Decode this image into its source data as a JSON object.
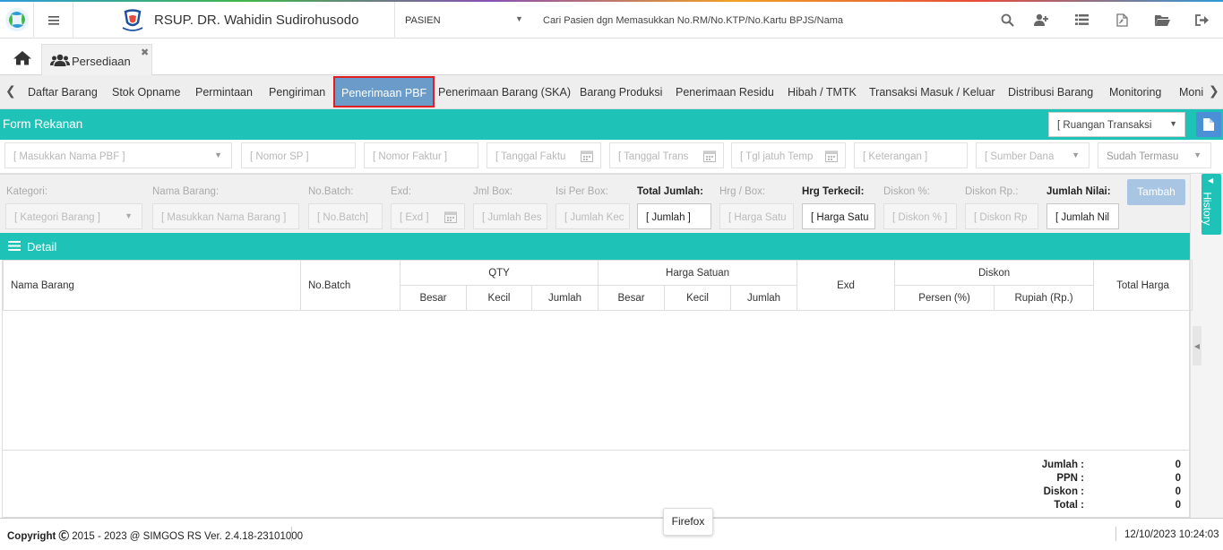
{
  "header": {
    "hospital_name": "RSUP. DR. Wahidin Sudirohusodo",
    "patient_select": "PASIEN",
    "search_placeholder": "Cari Pasien dgn Memasukkan No.RM/No.KTP/No.Kartu BPJS/Nama"
  },
  "tabs": {
    "page_tab": "Persediaan"
  },
  "menu": {
    "items": [
      "Daftar Barang",
      "Stok Opname",
      "Permintaan",
      "Pengiriman",
      "Penerimaan PBF",
      "Penerimaan Barang (SKA)",
      "Barang Produksi",
      "Penerimaan Residu",
      "Hibah / TMTK",
      "Transaksi Masuk / Keluar",
      "Distribusi Barang",
      "Monitoring",
      "Moni"
    ],
    "active": "Penerimaan PBF"
  },
  "form": {
    "title": "Form Rekanan",
    "ruangan_select": "[ Ruangan Transaksi",
    "filters": {
      "pbf": "[ Masukkan Nama PBF ]",
      "nomor_sp": "[ Nomor SP ]",
      "nomor_faktur": "[ Nomor Faktur ]",
      "tanggal_faktur": "[ Tanggal Faktu",
      "tanggal_transaksi": "[ Tanggal Trans",
      "tgl_jatuh_tempo": "[ Tgl jatuh Temp",
      "keterangan": "[ Keterangan ]",
      "sumber_dana": "[ Sumber Dana",
      "sudah_termasuk": "Sudah Termasu"
    }
  },
  "entry": {
    "labels": {
      "kategori": "Kategori:",
      "nama_barang": "Nama Barang:",
      "no_batch": "No.Batch:",
      "exd": "Exd:",
      "jml_box": "Jml Box:",
      "isi_per_box": "Isi Per Box:",
      "total_jumlah": "Total Jumlah:",
      "hrg_box": "Hrg / Box:",
      "hrg_terkecil": "Hrg Terkecil:",
      "diskon_persen": "Diskon %:",
      "diskon_rp": "Diskon Rp.:",
      "jumlah_nilai": "Jumlah Nilai:"
    },
    "placeholders": {
      "kategori": "[ Kategori Barang ]",
      "nama_barang": "[ Masukkan Nama Barang ]",
      "no_batch": "[ No.Batch]",
      "exd": "[ Exd ]",
      "jml_box": "[ Jumlah Bes",
      "isi_per_box": "[ Jumlah Kec",
      "total_jumlah": "[ Jumlah ]",
      "hrg_box": "[ Harga Satu",
      "hrg_terkecil": "[ Harga Satu",
      "diskon_persen": "[ Diskon % ]",
      "diskon_rp": "[ Diskon Rp",
      "jumlah_nilai": "[ Jumlah Nil"
    },
    "add_button": "Tambah"
  },
  "detail": {
    "title": "Detail",
    "columns": {
      "nama_barang": "Nama Barang",
      "no_batch": "No.Batch",
      "qty": "QTY",
      "harga_satuan": "Harga Satuan",
      "exd": "Exd",
      "diskon": "Diskon",
      "total_harga": "Total Harga",
      "besar": "Besar",
      "kecil": "Kecil",
      "jumlah": "Jumlah",
      "persen": "Persen (%)",
      "rupiah": "Rupiah (Rp.)"
    },
    "totals": [
      {
        "label": "Jumlah :",
        "value": "0"
      },
      {
        "label": "PPN :",
        "value": "0"
      },
      {
        "label": "Diskon :",
        "value": "0"
      },
      {
        "label": "Total :",
        "value": "0"
      }
    ]
  },
  "side": {
    "history_label": "History"
  },
  "footer": {
    "copyright_label": "Copyright",
    "copyright_text": "2015 - 2023 @ SIMGOS RS Ver. 2.4.18-23101000",
    "datetime": "12/10/2023 10:24:03",
    "tooltip": "Firefox"
  },
  "colors": {
    "teal": "#1fc2b7",
    "active_tab": "#6a9bc9",
    "active_border": "#e02020",
    "doc_button": "#4b8fd6"
  }
}
